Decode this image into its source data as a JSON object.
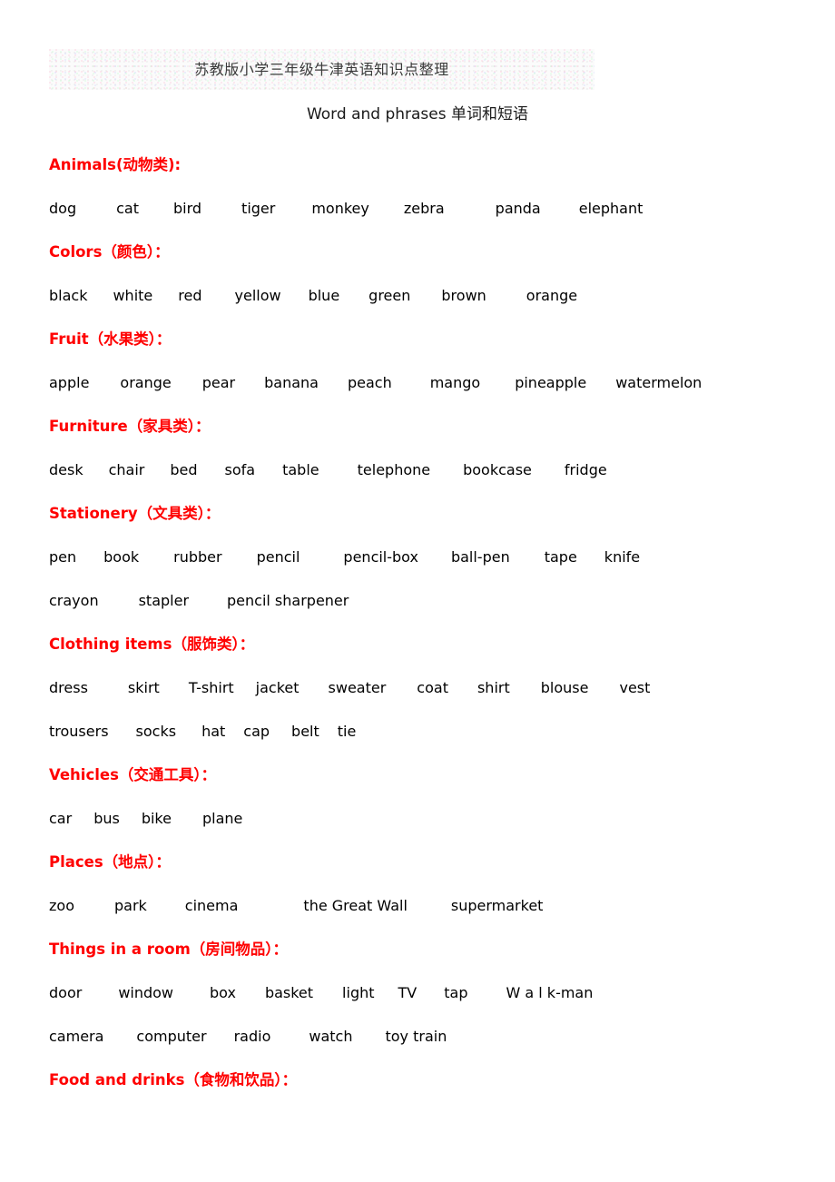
{
  "document": {
    "title": "苏教版小学三年级牛津英语知识点整理",
    "subtitle": "Word and phrases 单词和短语",
    "heading_color": "#ff0000",
    "body_color": "#000000",
    "page_background": "#ffffff"
  },
  "sections": [
    {
      "heading": "Animals(动物类):",
      "rows": [
        {
          "gaps": [
            44,
            38,
            44,
            40,
            38,
            56,
            42
          ],
          "words": [
            "dog",
            "cat",
            "bird",
            "tiger",
            "monkey",
            "zebra",
            "panda",
            "elephant"
          ]
        }
      ]
    },
    {
      "heading": "Colors（颜色）：",
      "rows": [
        {
          "gaps": [
            28,
            28,
            36,
            30,
            32,
            34,
            44
          ],
          "words": [
            "black",
            "white",
            "red",
            "yellow",
            "blue",
            "green",
            "brown",
            "orange"
          ]
        }
      ]
    },
    {
      "heading": "Fruit（水果类）：",
      "rows": [
        {
          "gaps": [
            34,
            34,
            32,
            32,
            42,
            38,
            32
          ],
          "words": [
            "apple",
            "orange",
            "pear",
            "banana",
            "peach",
            "mango",
            "pineapple",
            "watermelon"
          ]
        }
      ]
    },
    {
      "heading": "Furniture（家具类）：",
      "rows": [
        {
          "gaps": [
            28,
            28,
            30,
            30,
            42,
            36,
            36
          ],
          "words": [
            "desk",
            "chair",
            "bed",
            "sofa",
            "table",
            "telephone",
            "bookcase",
            "fridge"
          ]
        }
      ]
    },
    {
      "heading": "Stationery（文具类）：",
      "rows": [
        {
          "gaps": [
            30,
            38,
            38,
            48,
            36,
            38,
            30
          ],
          "words": [
            "pen",
            "book",
            "rubber",
            "pencil",
            "pencil-box",
            "ball-pen",
            "tape",
            "knife"
          ]
        },
        {
          "gaps": [
            44,
            42
          ],
          "words": [
            "crayon",
            "stapler",
            "pencil sharpener"
          ]
        }
      ]
    },
    {
      "heading": "Clothing items（服饰类）：",
      "rows": [
        {
          "gaps": [
            44,
            32,
            24,
            32,
            34,
            32,
            34,
            34
          ],
          "words": [
            "dress",
            "skirt",
            "T-shirt",
            "jacket",
            "sweater",
            "coat",
            "shirt",
            "blouse",
            "vest"
          ]
        },
        {
          "gaps": [
            30,
            28,
            20,
            24,
            20
          ],
          "words": [
            "trousers",
            "socks",
            "hat",
            "cap",
            "belt",
            "tie"
          ]
        }
      ]
    },
    {
      "heading": "Vehicles（交通工具）：",
      "rows": [
        {
          "gaps": [
            24,
            24,
            34
          ],
          "words": [
            "car",
            "bus",
            "bike",
            "plane"
          ]
        }
      ]
    },
    {
      "heading": "Places（地点）：",
      "rows": [
        {
          "gaps": [
            44,
            42,
            72,
            48
          ],
          "words": [
            "zoo",
            "park",
            "cinema",
            "the Great Wall",
            "supermarket"
          ]
        }
      ]
    },
    {
      "heading": "Things in a room（房间物品）：",
      "rows": [
        {
          "gaps": [
            40,
            40,
            32,
            32,
            26,
            30,
            42
          ],
          "words": [
            "door",
            "window",
            "box",
            "basket",
            "light",
            "TV",
            "tap",
            "W a l k-man"
          ]
        },
        {
          "gaps": [
            36,
            30,
            42,
            36
          ],
          "words": [
            "camera",
            "computer",
            "radio",
            "watch",
            "toy train"
          ]
        }
      ]
    },
    {
      "heading": "Food and drinks（食物和饮品）：",
      "rows": []
    }
  ]
}
